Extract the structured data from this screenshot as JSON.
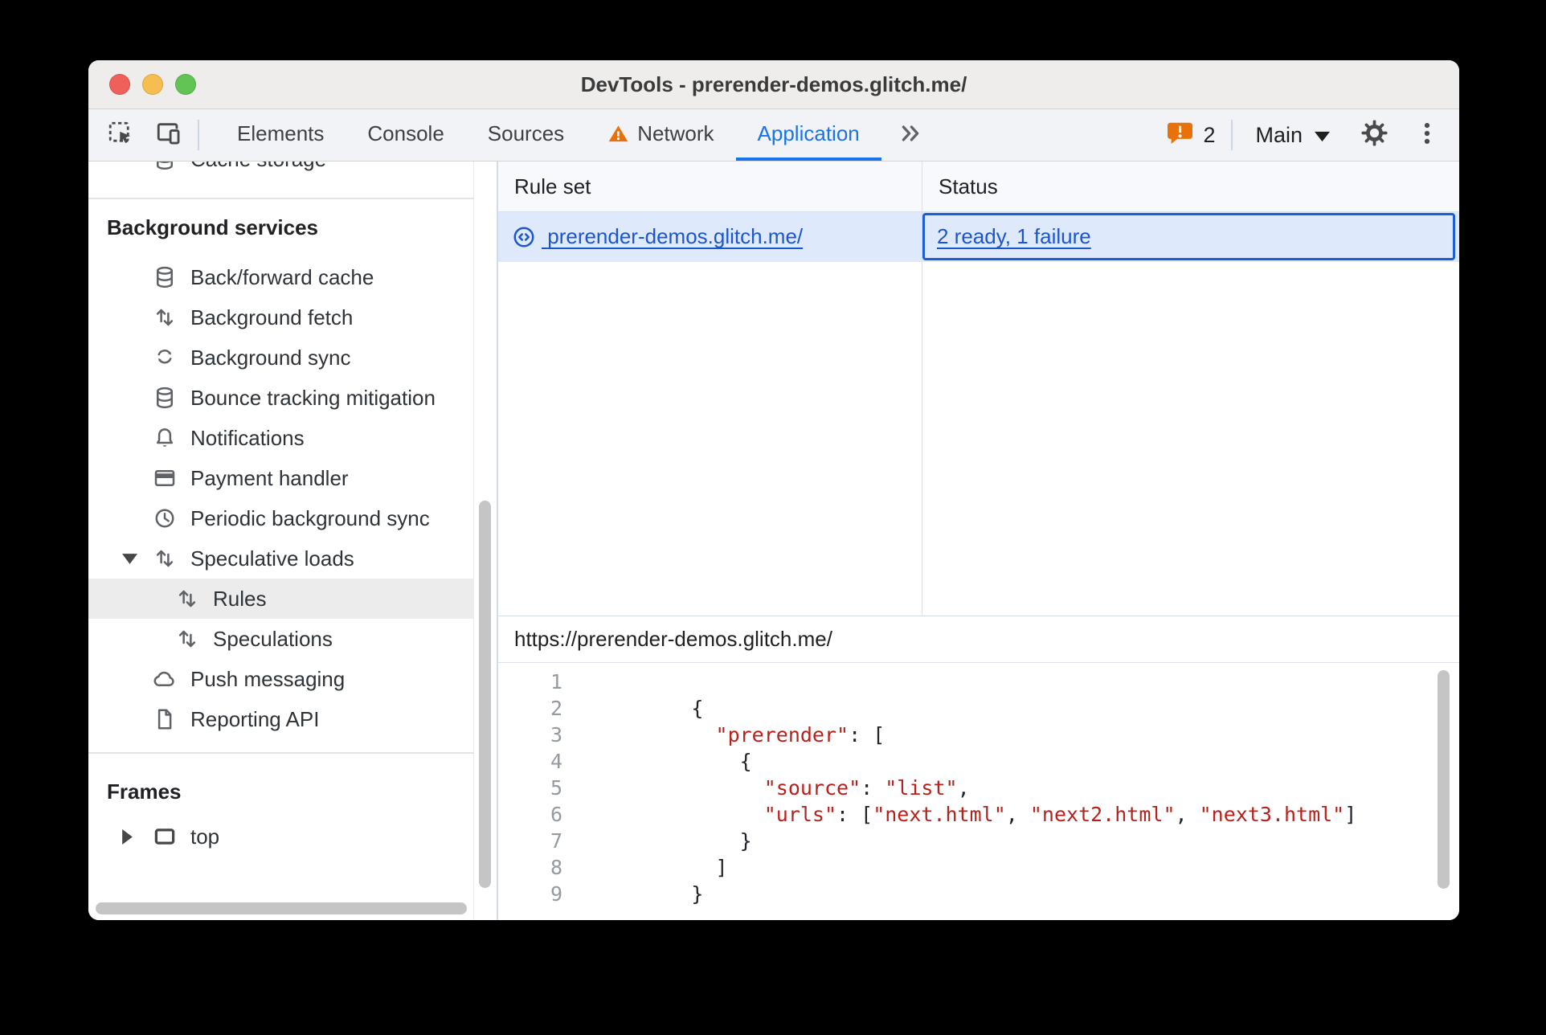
{
  "window": {
    "title": "DevTools - prerender-demos.glitch.me/"
  },
  "toolbar": {
    "tabs": [
      {
        "label": "Elements"
      },
      {
        "label": "Console"
      },
      {
        "label": "Sources"
      },
      {
        "label": "Network",
        "has_warning": true
      },
      {
        "label": "Application",
        "active": true
      }
    ],
    "issues_count": "2",
    "target_selector": {
      "value": "Main"
    }
  },
  "icons": [
    "inspect-icon",
    "device-toolbar-icon",
    "network-warning-icon",
    "more-tabs-icon",
    "issues-badge-icon",
    "dropdown-arrow-icon",
    "gear-icon",
    "kebab-menu-icon",
    "database-icon",
    "arrows-up-down-icon",
    "sync-icon",
    "bell-icon",
    "credit-card-icon",
    "clock-icon",
    "cloud-icon",
    "document-icon",
    "frame-icon",
    "rule-set-icon",
    "twisty-down-icon",
    "twisty-right-icon"
  ],
  "sidebar": {
    "clipped_item": {
      "label": "Cache storage",
      "icon": "database"
    },
    "sections": [
      {
        "title": "Background services",
        "items": [
          {
            "label": "Back/forward cache",
            "icon": "database"
          },
          {
            "label": "Background fetch",
            "icon": "arrows-up-down"
          },
          {
            "label": "Background sync",
            "icon": "sync"
          },
          {
            "label": "Bounce tracking mitigation",
            "icon": "database"
          },
          {
            "label": "Notifications",
            "icon": "bell"
          },
          {
            "label": "Payment handler",
            "icon": "credit-card"
          },
          {
            "label": "Periodic background sync",
            "icon": "clock"
          },
          {
            "label": "Speculative loads",
            "icon": "arrows-up-down",
            "expanded": true
          },
          {
            "label": "Rules",
            "icon": "arrows-up-down",
            "child": true,
            "selected": true
          },
          {
            "label": "Speculations",
            "icon": "arrows-up-down",
            "child": true
          },
          {
            "label": "Push messaging",
            "icon": "cloud"
          },
          {
            "label": "Reporting API",
            "icon": "document"
          }
        ]
      },
      {
        "title": "Frames",
        "items": [
          {
            "label": "top",
            "icon": "frame",
            "expandable": true
          }
        ]
      }
    ]
  },
  "main": {
    "table": {
      "columns": [
        "Rule set",
        "Status"
      ],
      "row": {
        "rule_set": "prerender-demos.glitch.me/",
        "status": "2 ready, 1 failure"
      }
    },
    "preview": {
      "url": "https://prerender-demos.glitch.me/",
      "code": {
        "lines": [
          {
            "n": "1",
            "segs": []
          },
          {
            "n": "2",
            "segs": [
              [
                "p",
                "        {"
              ]
            ]
          },
          {
            "n": "3",
            "segs": [
              [
                "p",
                "          "
              ],
              [
                "s",
                "\"prerender\""
              ],
              [
                "p",
                ": ["
              ]
            ]
          },
          {
            "n": "4",
            "segs": [
              [
                "p",
                "            {"
              ]
            ]
          },
          {
            "n": "5",
            "segs": [
              [
                "p",
                "              "
              ],
              [
                "s",
                "\"source\""
              ],
              [
                "p",
                ": "
              ],
              [
                "s",
                "\"list\""
              ],
              [
                "p",
                ","
              ]
            ]
          },
          {
            "n": "6",
            "segs": [
              [
                "p",
                "              "
              ],
              [
                "s",
                "\"urls\""
              ],
              [
                "p",
                ": ["
              ],
              [
                "s",
                "\"next.html\""
              ],
              [
                "p",
                ", "
              ],
              [
                "s",
                "\"next2.html\""
              ],
              [
                "p",
                ", "
              ],
              [
                "s",
                "\"next3.html\""
              ],
              [
                "p",
                "]"
              ]
            ]
          },
          {
            "n": "7",
            "segs": [
              [
                "p",
                "            }"
              ]
            ]
          },
          {
            "n": "8",
            "segs": [
              [
                "p",
                "          ]"
              ]
            ]
          },
          {
            "n": "9",
            "segs": [
              [
                "p",
                "        }"
              ]
            ]
          }
        ]
      }
    }
  },
  "colors": {
    "accent_blue": "#1a73e8",
    "link_blue": "#1c55d0",
    "warning_orange": "#e8710a",
    "code_string_red": "#b8211b",
    "selected_row_bg": "#dfe9fc"
  }
}
